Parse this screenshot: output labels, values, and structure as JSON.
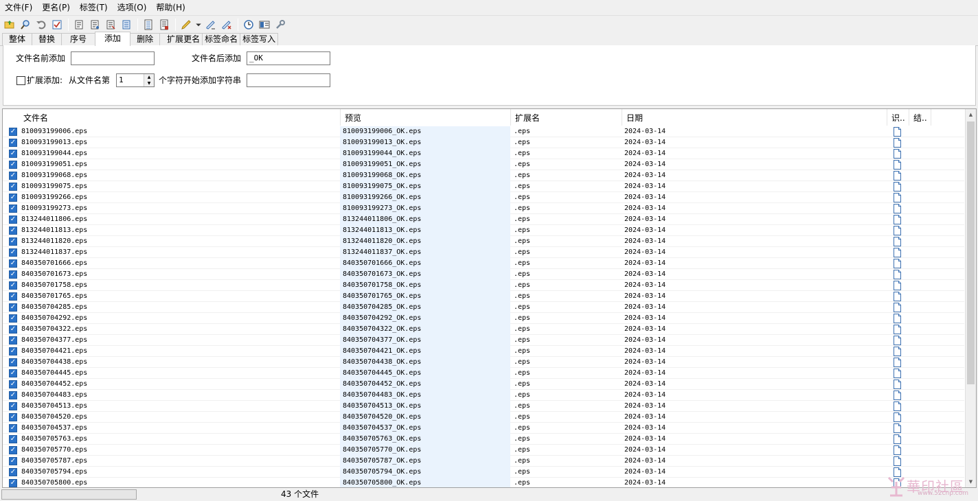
{
  "menu": [
    "文件(F)",
    "更名(P)",
    "标签(T)",
    "选项(O)",
    "帮助(H)"
  ],
  "toolbar": {
    "icons": [
      "open-folder-icon",
      "search-icon",
      "undo-icon",
      "check-icon",
      "tag-icon-1",
      "tag-icon-2",
      "tag-icon-3",
      "tag-icon-4",
      "list-icon",
      "edit-list-icon",
      "marker-icon",
      "dropdown-arrow-icon",
      "pen-icon",
      "pen-remove-icon",
      "clock-icon",
      "panel-icon",
      "wrench-icon"
    ]
  },
  "tabs": [
    {
      "label": "整体",
      "active": false
    },
    {
      "label": "替换",
      "active": false
    },
    {
      "label": "序号",
      "active": false
    },
    {
      "label": "添加",
      "active": true
    },
    {
      "label": "删除",
      "active": false
    },
    {
      "label": "扩展更名",
      "active": false
    },
    {
      "label": "标签命名",
      "active": false
    },
    {
      "label": "标签写入",
      "active": false
    }
  ],
  "panel": {
    "prefix_label": "文件名前添加",
    "prefix_value": "",
    "suffix_label": "文件名后添加",
    "suffix_value": "_OK",
    "ext_checkbox_label": "扩展添加:",
    "ext_from_label": "从文件名第",
    "ext_position": "1",
    "ext_after_label": "个字符开始添加字符串",
    "ext_value": ""
  },
  "list": {
    "columns": [
      "文件名",
      "预览",
      "扩展名",
      "日期",
      "识..",
      "结.."
    ],
    "ext": ".eps",
    "date": "2024-03-14",
    "files": [
      "810093199006",
      "810093199013",
      "810093199044",
      "810093199051",
      "810093199068",
      "810093199075",
      "810093199266",
      "810093199273",
      "813244011806",
      "813244011813",
      "813244011820",
      "813244011837",
      "840350701666",
      "840350701673",
      "840350701758",
      "840350701765",
      "840350704285",
      "840350704292",
      "840350704322",
      "840350704377",
      "840350704421",
      "840350704438",
      "840350704445",
      "840350704452",
      "840350704483",
      "840350704513",
      "840350704520",
      "840350704537",
      "840350705763",
      "840350705770",
      "840350705787",
      "840350705794",
      "840350705800"
    ]
  },
  "status": {
    "count_text": "43 个文件"
  },
  "watermark": {
    "text": "華印社區",
    "sub": "www.52cnp.com"
  },
  "colors": {
    "checkbox": "#2a72c8",
    "preview_bg": "#eaf3fd",
    "watermark": "#e7b8d0"
  }
}
